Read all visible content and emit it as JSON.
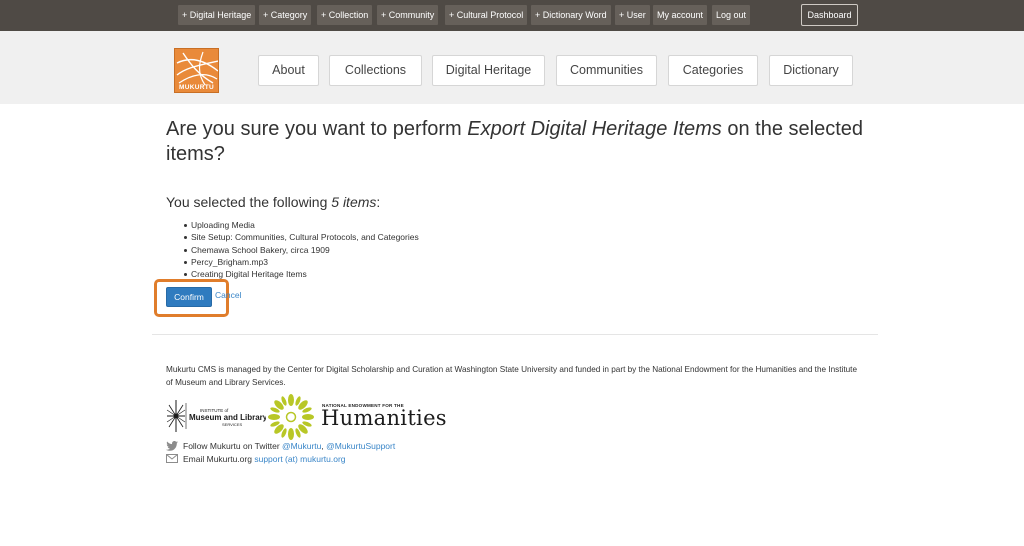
{
  "topbar": {
    "buttons": [
      "+ Digital Heritage",
      "+ Category",
      "+ Collection",
      "+ Community",
      "+ Cultural Protocol",
      "+ Dictionary Word",
      "+ User",
      "My account",
      "Log out"
    ],
    "dashboard": "Dashboard"
  },
  "header": {
    "logo_text": "MUKURTU",
    "nav": [
      "About",
      "Collections",
      "Digital Heritage",
      "Communities",
      "Categories",
      "Dictionary"
    ]
  },
  "main": {
    "title_pre": "Are you sure you want to perform ",
    "title_action": "Export Digital Heritage Items",
    "title_post": " on the selected items?",
    "subtitle_pre": "You selected the following ",
    "subtitle_count": "5 items",
    "subtitle_post": ":",
    "items": [
      "Uploading Media",
      "Site Setup: Communities, Cultural Protocols, and Categories",
      "Chemawa School Bakery, circa 1909",
      "Percy_Brigham.mp3",
      "Creating Digital Heritage Items"
    ],
    "confirm_label": "Confirm",
    "cancel_label": "Cancel"
  },
  "footer": {
    "text": "Mukurtu CMS is managed by the Center for Digital Scholarship and Curation at Washington State University and funded in part by the National Endowment for the Humanities and the Institute of Museum and Library Services.",
    "imls_line1": "INSTITUTE of",
    "imls_line2": "Museum and Library",
    "imls_line3": "SERVICES",
    "neh_small": "NATIONAL ENDOWMENT FOR THE",
    "neh_big": "Humanities",
    "twitter_text": "Follow Mukurtu on Twitter ",
    "twitter_link1": "@Mukurtu",
    "twitter_sep": ", ",
    "twitter_link2": "@MukurtuSupport",
    "email_text": "Email Mukurtu.org ",
    "email_link": "support (at) mukurtu.org"
  },
  "colors": {
    "topbar_bg": "#4f4a45",
    "accent_orange": "#e07d2b",
    "confirm_blue": "#2f7bbf",
    "link_blue": "#3a86c8"
  }
}
